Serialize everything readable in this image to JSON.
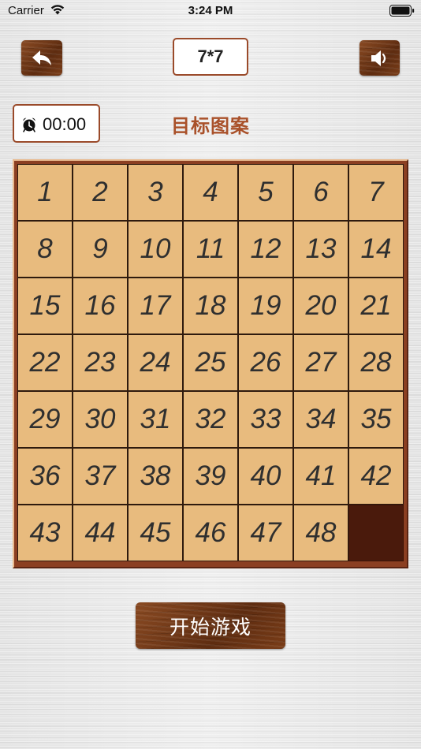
{
  "status_bar": {
    "carrier": "Carrier",
    "time": "3:24 PM"
  },
  "header": {
    "back_icon": "back-arrow-icon",
    "size_label": "7*7",
    "sound_icon": "speaker-icon"
  },
  "timer": {
    "icon": "alarm-clock-icon",
    "value": "00:00"
  },
  "target_label": "目标图案",
  "board": {
    "rows": 7,
    "cols": 7,
    "tiles": [
      "1",
      "2",
      "3",
      "4",
      "5",
      "6",
      "7",
      "8",
      "9",
      "10",
      "11",
      "12",
      "13",
      "14",
      "15",
      "16",
      "17",
      "18",
      "19",
      "20",
      "21",
      "22",
      "23",
      "24",
      "25",
      "26",
      "27",
      "28",
      "29",
      "30",
      "31",
      "32",
      "33",
      "34",
      "35",
      "36",
      "37",
      "38",
      "39",
      "40",
      "41",
      "42",
      "43",
      "44",
      "45",
      "46",
      "47",
      "48",
      ""
    ],
    "empty_index": 48
  },
  "start_button_label": "开始游戏",
  "colors": {
    "tile": "#e8bb7e",
    "empty_tile": "#4a1a0c",
    "board_frame": "#8b3f22",
    "accent_text": "#a9512a",
    "wood": "#6b3414"
  }
}
